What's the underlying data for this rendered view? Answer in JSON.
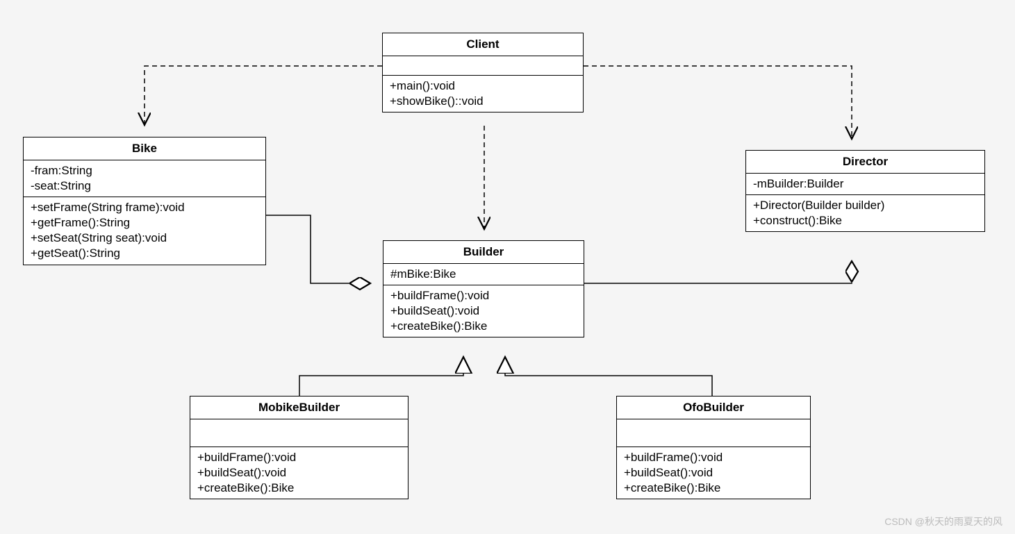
{
  "classes": {
    "client": {
      "name": "Client",
      "attrs": [],
      "ops": [
        "+main():void",
        "+showBike()::void"
      ]
    },
    "bike": {
      "name": "Bike",
      "attrs": [
        "-fram:String",
        "-seat:String"
      ],
      "ops": [
        "+setFrame(String frame):void",
        "+getFrame():String",
        "+setSeat(String seat):void",
        "+getSeat():String"
      ]
    },
    "builder": {
      "name": "Builder",
      "attrs": [
        "#mBike:Bike"
      ],
      "ops": [
        "+buildFrame():void",
        "+buildSeat():void",
        "+createBike():Bike"
      ]
    },
    "director": {
      "name": "Director",
      "attrs": [
        "-mBuilder:Builder"
      ],
      "ops": [
        "+Director(Builder builder)",
        "+construct():Bike"
      ]
    },
    "mobike": {
      "name": "MobikeBuilder",
      "attrs": [],
      "ops": [
        "+buildFrame():void",
        "+buildSeat():void",
        "+createBike():Bike"
      ]
    },
    "ofo": {
      "name": "OfoBuilder",
      "attrs": [],
      "ops": [
        "+buildFrame():void",
        "+buildSeat():void",
        "+createBike():Bike"
      ]
    }
  },
  "watermark": "CSDN @秋天的雨夏天的风"
}
